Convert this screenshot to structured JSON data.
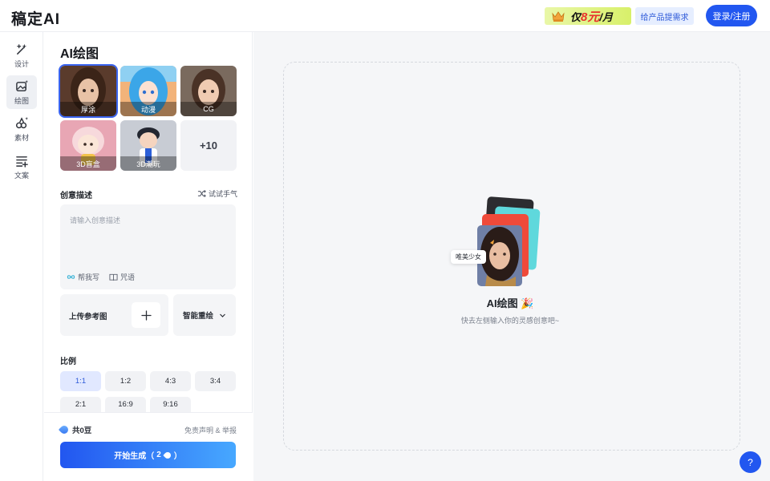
{
  "header": {
    "logo": "稿定AI",
    "promo_prefix": "仅",
    "promo_price": "8元",
    "promo_suffix": "/月",
    "feedback": "给产品提需求",
    "login": "登录/注册"
  },
  "rail": {
    "items": [
      {
        "label": "设计",
        "icon": "magic-wand-icon"
      },
      {
        "label": "绘图",
        "icon": "image-sparkle-icon"
      },
      {
        "label": "素材",
        "icon": "shapes-icon"
      },
      {
        "label": "文案",
        "icon": "text-lines-icon"
      }
    ]
  },
  "panel": {
    "title": "AI绘图",
    "styles": [
      {
        "label": "厚涂"
      },
      {
        "label": "动漫"
      },
      {
        "label": "CG"
      },
      {
        "label": "3D盲盒"
      },
      {
        "label": "3D潮玩"
      }
    ],
    "more_styles": "+10",
    "prompt_section": "创意描述",
    "shuffle": "试试手气",
    "prompt_placeholder": "请输入创意描述",
    "help_write": "帮我写",
    "spell": "咒语",
    "upload_label": "上传参考图",
    "mode_label": "智能重绘",
    "ratio_section": "比例",
    "ratios": [
      "1:1",
      "1:2",
      "4:3",
      "3:4",
      "2:1",
      "16:9",
      "9:16"
    ],
    "selected_ratio": "1:1",
    "beans": "共0豆",
    "disclaimer": "免责声明 & 举报",
    "generate_prefix": "开始生成（",
    "generate_cost": "2",
    "generate_suffix": "）"
  },
  "canvas": {
    "tag": "唯美少女",
    "title": "AI绘图 🎉",
    "subtitle": "快去左侧输入你的灵感创意吧~"
  },
  "help": "?",
  "colors": {
    "accent": "#2257f0",
    "selected_ratio_bg": "#e1e8ff"
  }
}
